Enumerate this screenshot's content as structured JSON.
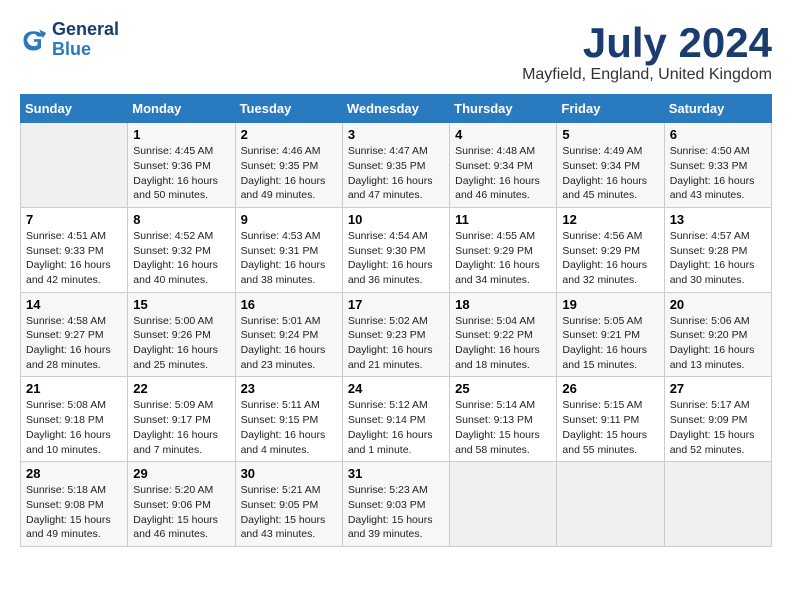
{
  "header": {
    "logo_line1": "General",
    "logo_line2": "Blue",
    "month_title": "July 2024",
    "location": "Mayfield, England, United Kingdom"
  },
  "days_of_week": [
    "Sunday",
    "Monday",
    "Tuesday",
    "Wednesday",
    "Thursday",
    "Friday",
    "Saturday"
  ],
  "weeks": [
    [
      {
        "num": "",
        "sunrise": "",
        "sunset": "",
        "daylight": ""
      },
      {
        "num": "1",
        "sunrise": "Sunrise: 4:45 AM",
        "sunset": "Sunset: 9:36 PM",
        "daylight": "Daylight: 16 hours and 50 minutes."
      },
      {
        "num": "2",
        "sunrise": "Sunrise: 4:46 AM",
        "sunset": "Sunset: 9:35 PM",
        "daylight": "Daylight: 16 hours and 49 minutes."
      },
      {
        "num": "3",
        "sunrise": "Sunrise: 4:47 AM",
        "sunset": "Sunset: 9:35 PM",
        "daylight": "Daylight: 16 hours and 47 minutes."
      },
      {
        "num": "4",
        "sunrise": "Sunrise: 4:48 AM",
        "sunset": "Sunset: 9:34 PM",
        "daylight": "Daylight: 16 hours and 46 minutes."
      },
      {
        "num": "5",
        "sunrise": "Sunrise: 4:49 AM",
        "sunset": "Sunset: 9:34 PM",
        "daylight": "Daylight: 16 hours and 45 minutes."
      },
      {
        "num": "6",
        "sunrise": "Sunrise: 4:50 AM",
        "sunset": "Sunset: 9:33 PM",
        "daylight": "Daylight: 16 hours and 43 minutes."
      }
    ],
    [
      {
        "num": "7",
        "sunrise": "Sunrise: 4:51 AM",
        "sunset": "Sunset: 9:33 PM",
        "daylight": "Daylight: 16 hours and 42 minutes."
      },
      {
        "num": "8",
        "sunrise": "Sunrise: 4:52 AM",
        "sunset": "Sunset: 9:32 PM",
        "daylight": "Daylight: 16 hours and 40 minutes."
      },
      {
        "num": "9",
        "sunrise": "Sunrise: 4:53 AM",
        "sunset": "Sunset: 9:31 PM",
        "daylight": "Daylight: 16 hours and 38 minutes."
      },
      {
        "num": "10",
        "sunrise": "Sunrise: 4:54 AM",
        "sunset": "Sunset: 9:30 PM",
        "daylight": "Daylight: 16 hours and 36 minutes."
      },
      {
        "num": "11",
        "sunrise": "Sunrise: 4:55 AM",
        "sunset": "Sunset: 9:29 PM",
        "daylight": "Daylight: 16 hours and 34 minutes."
      },
      {
        "num": "12",
        "sunrise": "Sunrise: 4:56 AM",
        "sunset": "Sunset: 9:29 PM",
        "daylight": "Daylight: 16 hours and 32 minutes."
      },
      {
        "num": "13",
        "sunrise": "Sunrise: 4:57 AM",
        "sunset": "Sunset: 9:28 PM",
        "daylight": "Daylight: 16 hours and 30 minutes."
      }
    ],
    [
      {
        "num": "14",
        "sunrise": "Sunrise: 4:58 AM",
        "sunset": "Sunset: 9:27 PM",
        "daylight": "Daylight: 16 hours and 28 minutes."
      },
      {
        "num": "15",
        "sunrise": "Sunrise: 5:00 AM",
        "sunset": "Sunset: 9:26 PM",
        "daylight": "Daylight: 16 hours and 25 minutes."
      },
      {
        "num": "16",
        "sunrise": "Sunrise: 5:01 AM",
        "sunset": "Sunset: 9:24 PM",
        "daylight": "Daylight: 16 hours and 23 minutes."
      },
      {
        "num": "17",
        "sunrise": "Sunrise: 5:02 AM",
        "sunset": "Sunset: 9:23 PM",
        "daylight": "Daylight: 16 hours and 21 minutes."
      },
      {
        "num": "18",
        "sunrise": "Sunrise: 5:04 AM",
        "sunset": "Sunset: 9:22 PM",
        "daylight": "Daylight: 16 hours and 18 minutes."
      },
      {
        "num": "19",
        "sunrise": "Sunrise: 5:05 AM",
        "sunset": "Sunset: 9:21 PM",
        "daylight": "Daylight: 16 hours and 15 minutes."
      },
      {
        "num": "20",
        "sunrise": "Sunrise: 5:06 AM",
        "sunset": "Sunset: 9:20 PM",
        "daylight": "Daylight: 16 hours and 13 minutes."
      }
    ],
    [
      {
        "num": "21",
        "sunrise": "Sunrise: 5:08 AM",
        "sunset": "Sunset: 9:18 PM",
        "daylight": "Daylight: 16 hours and 10 minutes."
      },
      {
        "num": "22",
        "sunrise": "Sunrise: 5:09 AM",
        "sunset": "Sunset: 9:17 PM",
        "daylight": "Daylight: 16 hours and 7 minutes."
      },
      {
        "num": "23",
        "sunrise": "Sunrise: 5:11 AM",
        "sunset": "Sunset: 9:15 PM",
        "daylight": "Daylight: 16 hours and 4 minutes."
      },
      {
        "num": "24",
        "sunrise": "Sunrise: 5:12 AM",
        "sunset": "Sunset: 9:14 PM",
        "daylight": "Daylight: 16 hours and 1 minute."
      },
      {
        "num": "25",
        "sunrise": "Sunrise: 5:14 AM",
        "sunset": "Sunset: 9:13 PM",
        "daylight": "Daylight: 15 hours and 58 minutes."
      },
      {
        "num": "26",
        "sunrise": "Sunrise: 5:15 AM",
        "sunset": "Sunset: 9:11 PM",
        "daylight": "Daylight: 15 hours and 55 minutes."
      },
      {
        "num": "27",
        "sunrise": "Sunrise: 5:17 AM",
        "sunset": "Sunset: 9:09 PM",
        "daylight": "Daylight: 15 hours and 52 minutes."
      }
    ],
    [
      {
        "num": "28",
        "sunrise": "Sunrise: 5:18 AM",
        "sunset": "Sunset: 9:08 PM",
        "daylight": "Daylight: 15 hours and 49 minutes."
      },
      {
        "num": "29",
        "sunrise": "Sunrise: 5:20 AM",
        "sunset": "Sunset: 9:06 PM",
        "daylight": "Daylight: 15 hours and 46 minutes."
      },
      {
        "num": "30",
        "sunrise": "Sunrise: 5:21 AM",
        "sunset": "Sunset: 9:05 PM",
        "daylight": "Daylight: 15 hours and 43 minutes."
      },
      {
        "num": "31",
        "sunrise": "Sunrise: 5:23 AM",
        "sunset": "Sunset: 9:03 PM",
        "daylight": "Daylight: 15 hours and 39 minutes."
      },
      {
        "num": "",
        "sunrise": "",
        "sunset": "",
        "daylight": ""
      },
      {
        "num": "",
        "sunrise": "",
        "sunset": "",
        "daylight": ""
      },
      {
        "num": "",
        "sunrise": "",
        "sunset": "",
        "daylight": ""
      }
    ]
  ]
}
